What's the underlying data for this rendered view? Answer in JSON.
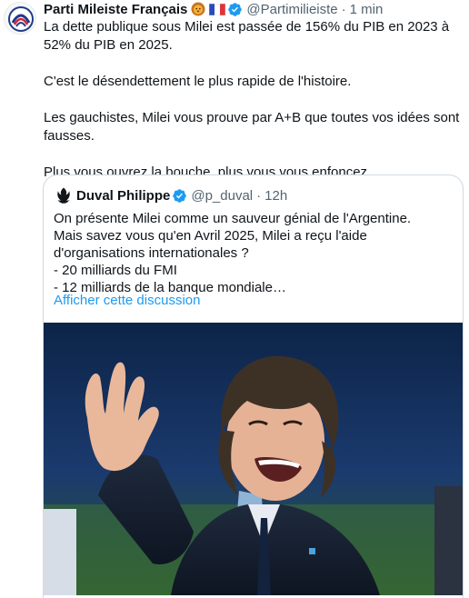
{
  "tweet": {
    "author_name": "Parti Mileiste Français",
    "handle": "@Partimilieiste",
    "separator": "·",
    "time": "1 min",
    "emojis": [
      "lion-emoji",
      "france-flag-emoji"
    ],
    "paragraphs": [
      "La dette publique sous Milei est passée de 156% du PIB en 2023 à 52% du PIB en 2025.",
      "C'est le désendettement le plus rapide de l'histoire.",
      "Les gauchistes, Milei vous prouve par A+B que toutes vos idées sont fausses.",
      "Plus vous ouvrez la bouche, plus vous vous enfoncez."
    ]
  },
  "quote": {
    "author_name": "Duval Philippe",
    "handle": "@p_duval",
    "separator": "·",
    "time": "12h",
    "lines": [
      "On présente Milei comme un sauveur génial de l'Argentine.",
      "Mais savez vous qu'en Avril 2025, Milei a reçu l'aide d'organisations internationales ?",
      "- 20 milliards du FMI",
      "- 12 milliards de la banque mondiale…"
    ],
    "show_thread": "Afficher cette discussion",
    "image_alt": "photo-of-man-waving"
  },
  "colors": {
    "text": "#0f1419",
    "secondary": "#536471",
    "link": "#1d9bf0",
    "verified": "#1d9bf0",
    "border": "#cfd9de"
  }
}
